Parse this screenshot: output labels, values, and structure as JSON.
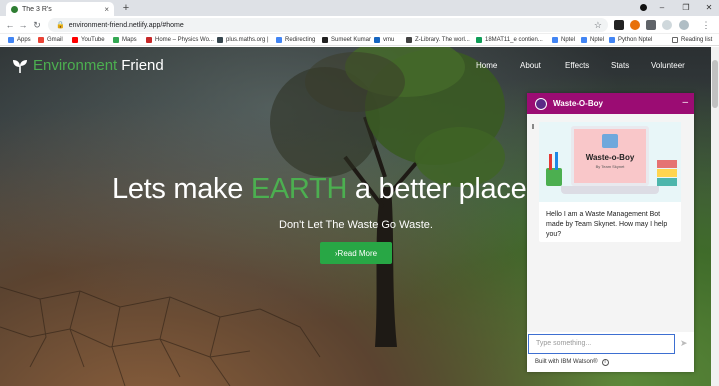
{
  "browser": {
    "tab_title": "The 3 R's",
    "tab_close": "×",
    "new_tab": "+",
    "url": "environment-friend.netlify.app/#home",
    "reading_list": "Reading list",
    "window_minimize": "–",
    "window_maximize": "❐",
    "window_close": "✕",
    "nav_back": "←",
    "nav_forward": "→",
    "nav_reload": "↻"
  },
  "bookmarks": [
    {
      "label": "Apps",
      "color": "#4285f4"
    },
    {
      "label": "Gmail",
      "color": "#ea4335"
    },
    {
      "label": "YouTube",
      "color": "#ff0000"
    },
    {
      "label": "Maps",
      "color": "#34a853"
    },
    {
      "label": "Home – Physics Wo...",
      "color": "#c62828"
    },
    {
      "label": "plus.maths.org |",
      "color": "#37474f"
    },
    {
      "label": "Redirecting",
      "color": "#4285f4"
    },
    {
      "label": "Sumeet Kumar",
      "color": "#212121"
    },
    {
      "label": "vmu",
      "color": "#1565c0"
    },
    {
      "label": "Z-Library. The worl...",
      "color": "#424242"
    },
    {
      "label": "18MAT11_e contien...",
      "color": "#0f9d58"
    },
    {
      "label": "Nptel",
      "color": "#4285f4"
    },
    {
      "label": "Nptel",
      "color": "#4285f4"
    },
    {
      "label": "Python Nptel",
      "color": "#4285f4"
    }
  ],
  "site": {
    "brand_first": "Environment",
    "brand_second": "Friend",
    "nav": [
      "Home",
      "About",
      "Effects",
      "Stats",
      "Volunteer"
    ],
    "hero_pre": "Lets make ",
    "hero_highlight": "EARTH",
    "hero_post": " a better place t",
    "subtitle": "Don't Let The Waste Go Waste.",
    "cta": "›Read More"
  },
  "chat": {
    "title": "Waste-O-Boy",
    "minimize": "–",
    "card_title": "Waste-o-Boy",
    "card_subtitle": "By Team Skynet",
    "message": "Hello I am a Waste Management Bot made by Team Skynet. How may I help you?",
    "input_placeholder": "Type something...",
    "send": "➤",
    "footer": "Built with IBM Watson®",
    "footer_info": "i"
  },
  "colors": {
    "brand_green": "#4caf50",
    "cta_green": "#28a745",
    "chat_header": "#9b0c73"
  }
}
